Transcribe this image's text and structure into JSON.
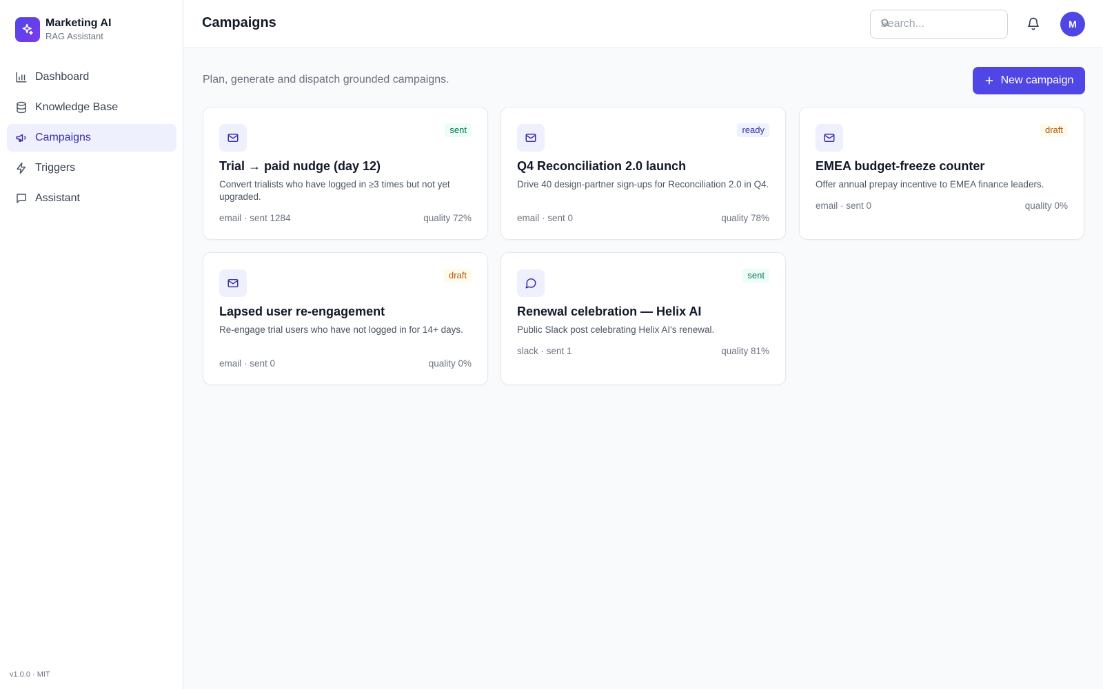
{
  "brand": {
    "title": "Marketing AI",
    "subtitle": "RAG Assistant",
    "icon": "sparkles-icon"
  },
  "sidebar": {
    "items": [
      {
        "label": "Dashboard",
        "icon": "bar-chart-icon",
        "active": false
      },
      {
        "label": "Knowledge Base",
        "icon": "database-icon",
        "active": false
      },
      {
        "label": "Campaigns",
        "icon": "megaphone-icon",
        "active": true
      },
      {
        "label": "Triggers",
        "icon": "zap-icon",
        "active": false
      },
      {
        "label": "Assistant",
        "icon": "message-square-icon",
        "active": false
      }
    ],
    "version": "v1.0.0 · MIT"
  },
  "header": {
    "title": "Campaigns",
    "search_placeholder": "Search...",
    "avatar_initial": "M"
  },
  "main": {
    "subtitle": "Plan, generate and dispatch grounded campaigns.",
    "new_button_label": "New campaign",
    "cards": [
      {
        "title": "Trial → paid nudge (day 12)",
        "status": "sent",
        "icon": "mail-icon",
        "description": "Convert trialists who have logged in ≥3 times but not yet upgraded.",
        "meta": "email · sent 1284",
        "quality": "quality 72%"
      },
      {
        "title": "Q4 Reconciliation 2.0 launch",
        "status": "ready",
        "icon": "mail-icon",
        "description": "Drive 40 design-partner sign-ups for Reconciliation 2.0 in Q4.",
        "meta": "email · sent 0",
        "quality": "quality 78%"
      },
      {
        "title": "EMEA budget-freeze counter",
        "status": "draft",
        "icon": "mail-icon",
        "description": "Offer annual prepay incentive to EMEA finance leaders.",
        "meta": "email · sent 0",
        "quality": "quality 0%"
      },
      {
        "title": "Lapsed user re-engagement",
        "status": "draft",
        "icon": "mail-icon",
        "description": "Re-engage trial users who have not logged in for 14+ days.",
        "meta": "email · sent 0",
        "quality": "quality 0%"
      },
      {
        "title": "Renewal celebration — Helix AI",
        "status": "sent",
        "icon": "message-circle-icon",
        "description": "Public Slack post celebrating Helix AI's renewal.",
        "meta": "slack · sent 1",
        "quality": "quality 81%"
      }
    ]
  },
  "colors": {
    "accent": "#4f46e5",
    "sent": "#047857",
    "ready": "#3730a3",
    "draft": "#b45309"
  }
}
